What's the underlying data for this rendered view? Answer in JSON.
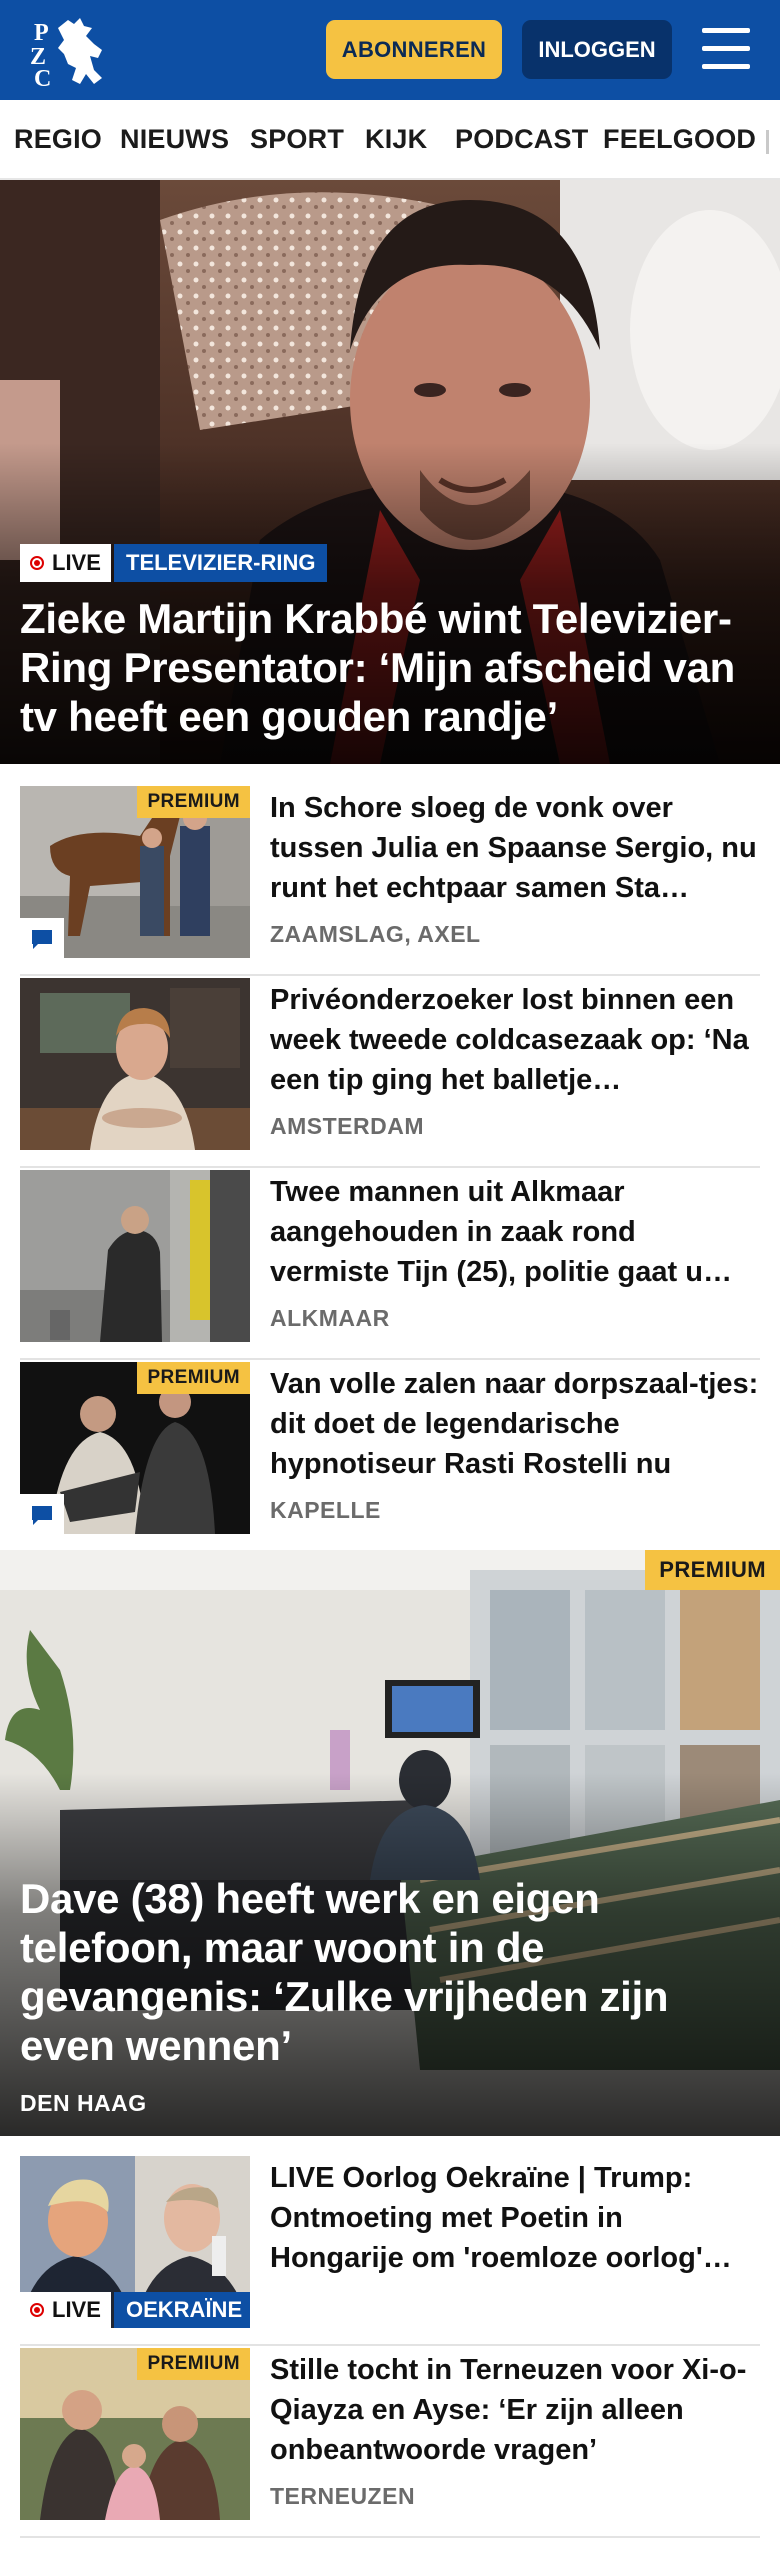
{
  "header": {
    "logo_text": "PZC",
    "subscribe_label": "ABONNEREN",
    "login_label": "INLOGGEN"
  },
  "nav": {
    "items": [
      "REGIO",
      "NIEUWS",
      "SPORT",
      "KIJK",
      "PODCAST",
      "FEELGOOD"
    ]
  },
  "hero": {
    "live_label": "LIVE",
    "topic_label": "TELEVIZIER-RING",
    "title": "Zieke Martijn Krabbé wint Televizier-Ring Presentator: ‘Mijn afscheid van tv heeft een gouden randje’"
  },
  "articles": [
    {
      "premium_label": "PREMIUM",
      "title": "In Schore sloeg de vonk over tussen Julia en Spaanse Sergio, nu runt het echtpaar samen Sta…",
      "location": "ZAAMSLAG, AXEL"
    },
    {
      "title": "Privéonderzoeker lost binnen een week tweede coldcasezaak op: ‘Na een tip ging het balletje…",
      "location": "AMSTERDAM"
    },
    {
      "title": "Twee mannen uit Alkmaar aangehouden in zaak rond vermiste Tijn (25), politie gaat u…",
      "location": "ALKMAAR"
    },
    {
      "premium_label": "PREMIUM",
      "title": "Van volle zalen naar dorpszaal-tjes: dit doet de legendarische hypnotiseur Rasti Rostelli nu",
      "location": "KAPELLE"
    }
  ],
  "feature": {
    "premium_label": "PREMIUM",
    "title": "Dave (38) heeft werk en eigen telefoon, maar woont in de gevangenis: ‘Zulke vrijheden zijn even wennen’",
    "location": "DEN HAAG"
  },
  "articles2": [
    {
      "live_label": "LIVE",
      "topic_label": "OEKRAÏNE",
      "title": "LIVE Oorlog Oekraïne | Trump: Ontmoeting met Poetin in Hongarije om 'roemloze oorlog'…"
    },
    {
      "premium_label": "PREMIUM",
      "title": "Stille tocht in Terneuzen voor Xi-o-Qiayza en Ayse: ‘Er zijn alleen onbeantwoorde vragen’",
      "location": "TERNEUZEN"
    }
  ],
  "colors": {
    "brand_blue": "#0d4fa4",
    "dark_blue": "#08326b",
    "accent_yellow": "#f5c242",
    "live_red": "#dd0000"
  }
}
